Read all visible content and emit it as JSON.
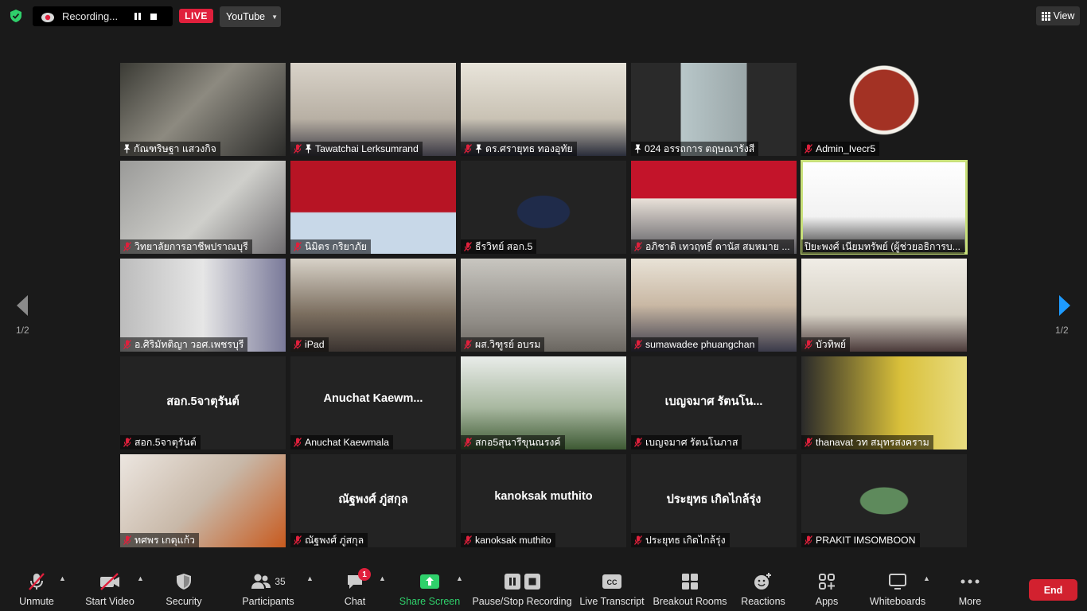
{
  "topbar": {
    "recording_label": "Recording...",
    "live_label": "LIVE",
    "stream_target": "YouTube",
    "view_label": "View"
  },
  "colors": {
    "accent_green": "#2fd06b",
    "live_red": "#e0203c",
    "end_red": "#d2212f",
    "active_speaker": "#c8e07a",
    "mic_muted": "#e0203c"
  },
  "pagination": {
    "left": "1/2",
    "right": "1/2"
  },
  "participants": [
    {
      "name": "กัณฑริษฐา  แสวงกิจ",
      "pinned": true,
      "muted": false,
      "video": true
    },
    {
      "name": "Tawatchai Lerksumrand",
      "pinned": true,
      "muted": true,
      "video": true
    },
    {
      "name": "ดร.ศรายุทธ ทองอุทัย",
      "pinned": true,
      "muted": true,
      "video": true
    },
    {
      "name": "024 อรรถการ ตฤษณารังสี",
      "pinned": true,
      "muted": false,
      "video": true
    },
    {
      "name": "Admin_Ivecr5",
      "pinned": false,
      "muted": true,
      "video": true
    },
    {
      "name": "วิทยาลัยการอาชีพปราณบุรี",
      "pinned": false,
      "muted": true,
      "video": true
    },
    {
      "name": "นิมิตร กริยาภัย",
      "pinned": false,
      "muted": true,
      "video": true
    },
    {
      "name": "ธีรวิทย์ สอก.5",
      "pinned": false,
      "muted": true,
      "video": true
    },
    {
      "name": "อภิชาติ เทวฤทธิ์ ดานัส  สมหมาย ...",
      "pinned": false,
      "muted": true,
      "video": true
    },
    {
      "name": "ปิยะพงศ์ เนียมทรัพย์ (ผู้ช่วยอธิการบ...",
      "pinned": false,
      "muted": false,
      "video": true,
      "active": true
    },
    {
      "name": "อ.ศิริมัทติญา วอศ.เพชรบุรี",
      "pinned": false,
      "muted": true,
      "video": true
    },
    {
      "name": "iPad",
      "pinned": false,
      "muted": true,
      "video": true
    },
    {
      "name": "ผส.วิฑูรย์ อบรม",
      "pinned": false,
      "muted": true,
      "video": true
    },
    {
      "name": "sumawadee phuangchan",
      "pinned": false,
      "muted": true,
      "video": true
    },
    {
      "name": "บัวทิพย์",
      "pinned": false,
      "muted": true,
      "video": true
    },
    {
      "name": "สอก.5จาตุรันต์",
      "pinned": false,
      "muted": true,
      "video": false,
      "center": "สอก.5จาตุรันต์"
    },
    {
      "name": "Anuchat Kaewmala",
      "pinned": false,
      "muted": true,
      "video": false,
      "center": "Anuchat  Kaewm..."
    },
    {
      "name": "สกอ5สุนารีขุนณรงค์",
      "pinned": false,
      "muted": true,
      "video": true
    },
    {
      "name": "เบญจมาศ รัตนโนภาส",
      "pinned": false,
      "muted": true,
      "video": false,
      "center": "เบญจมาศ รัตนโน..."
    },
    {
      "name": "thanavat วท สมุทรสงคราม",
      "pinned": false,
      "muted": true,
      "video": true
    },
    {
      "name": "ทศพร   เกตุแก้ว",
      "pinned": false,
      "muted": true,
      "video": true
    },
    {
      "name": "ณัฐพงศ์ ภู่สกุล",
      "pinned": false,
      "muted": true,
      "video": false,
      "center": "ณัฐพงศ์ ภู่สกุล"
    },
    {
      "name": "kanoksak muthito",
      "pinned": false,
      "muted": true,
      "video": false,
      "center": "kanoksak muthito"
    },
    {
      "name": "ประยุทธ เกิดไกล้รุ่ง",
      "pinned": false,
      "muted": true,
      "video": false,
      "center": "ประยุทธ เกิดไกล้รุ่ง"
    },
    {
      "name": "PRAKIT IMSOMBOON",
      "pinned": false,
      "muted": true,
      "video": true
    }
  ],
  "toolbar": {
    "unmute": "Unmute",
    "start_video": "Start Video",
    "security": "Security",
    "participants": "Participants",
    "participants_count": "35",
    "chat": "Chat",
    "chat_badge": "1",
    "share_screen": "Share Screen",
    "pause_stop": "Pause/Stop Recording",
    "live_transcript": "Live Transcript",
    "breakout_rooms": "Breakout Rooms",
    "reactions": "Reactions",
    "apps": "Apps",
    "whiteboards": "Whiteboards",
    "more": "More",
    "end": "End"
  }
}
